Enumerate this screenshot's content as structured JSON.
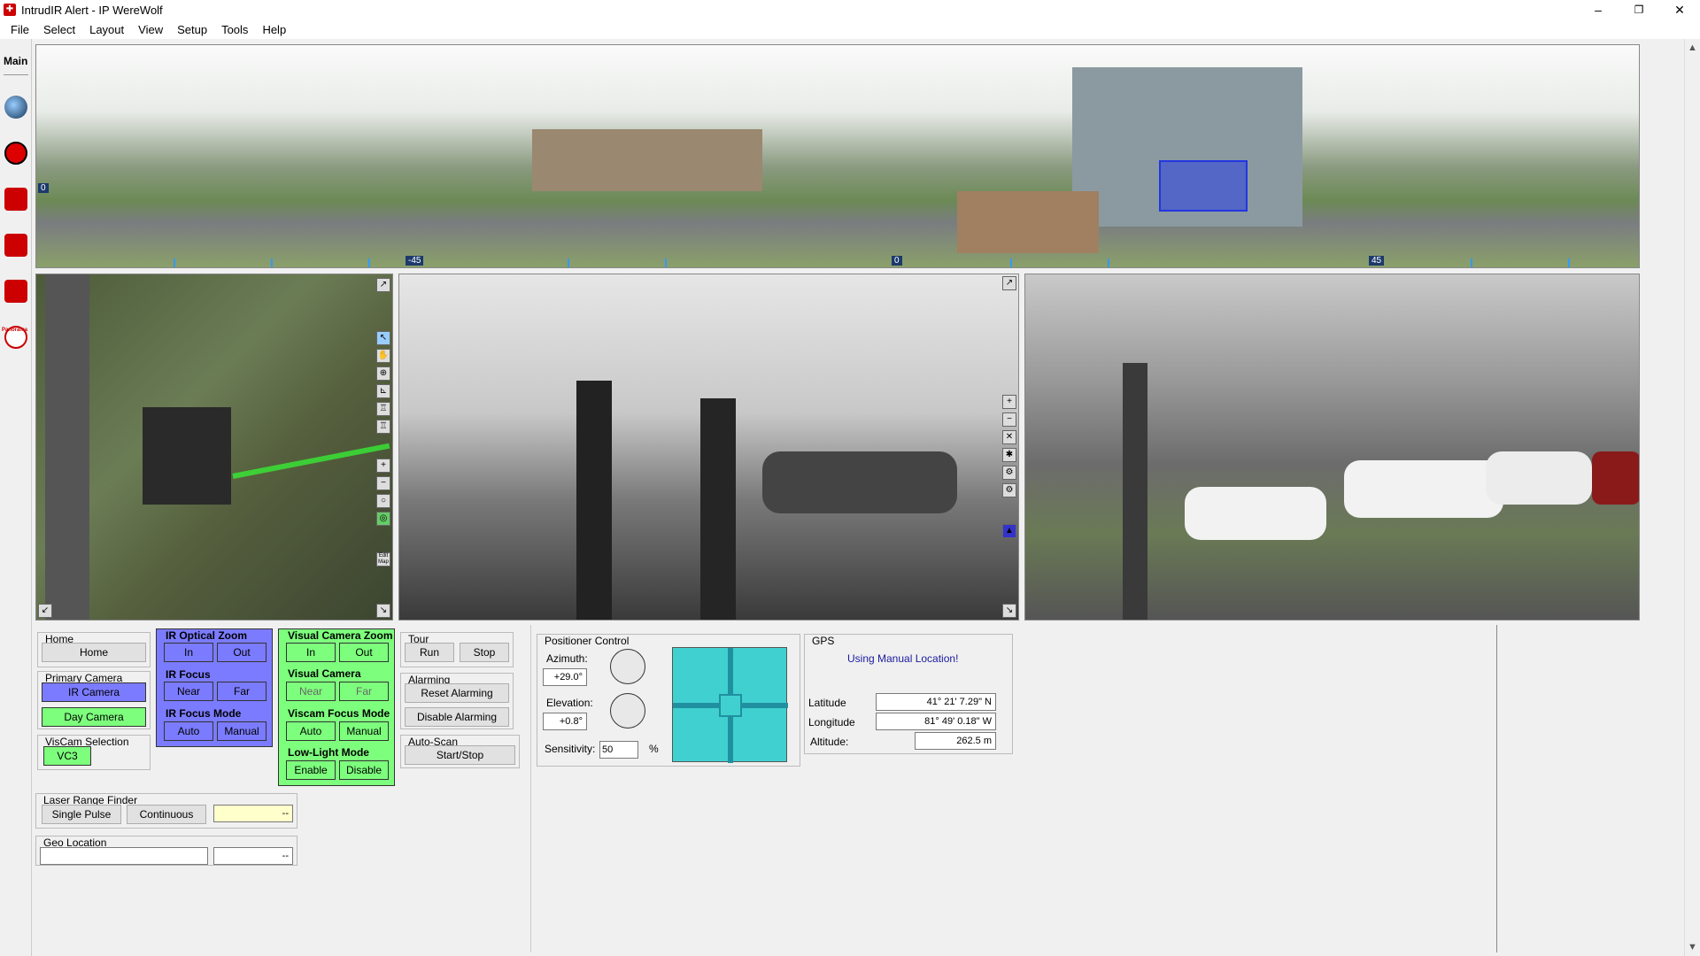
{
  "window": {
    "title": "IntrudIR Alert - IP WereWolf",
    "minimize": "–",
    "maximize": "❐",
    "close": "✕"
  },
  "menu": [
    "File",
    "Select",
    "Layout",
    "View",
    "Setup",
    "Tools",
    "Help"
  ],
  "sidebar": {
    "main_label": "Main",
    "items": [
      "globe-icon",
      "target-icon",
      "camera-icon-1",
      "camera-icon-2",
      "camera-icon-3",
      "panorama-icon"
    ],
    "panorama_caption": "Panorama"
  },
  "panorama": {
    "ticks": [
      "-45",
      "0",
      "45"
    ],
    "left_marker": "0"
  },
  "map_tools": {
    "edit_map": "Edit Map"
  },
  "controls": {
    "home": {
      "label": "Home",
      "button": "Home"
    },
    "primary_camera": {
      "label": "Primary Camera",
      "ir": "IR Camera",
      "day": "Day Camera"
    },
    "viscam_selection": {
      "label": "VisCam Selection",
      "value": "VC3"
    },
    "ir_optical_zoom": {
      "label": "IR Optical Zoom",
      "in": "In",
      "out": "Out"
    },
    "ir_focus": {
      "label": "IR Focus",
      "near": "Near",
      "far": "Far"
    },
    "ir_focus_mode": {
      "label": "IR Focus Mode",
      "auto": "Auto",
      "manual": "Manual"
    },
    "visual_zoom": {
      "label": "Visual Camera Zoom",
      "in": "In",
      "out": "Out"
    },
    "visual_camera": {
      "label": "Visual Camera",
      "near": "Near",
      "far": "Far"
    },
    "viscam_focus_mode": {
      "label": "Viscam Focus Mode",
      "auto": "Auto",
      "manual": "Manual"
    },
    "low_light": {
      "label": "Low-Light Mode",
      "enable": "Enable",
      "disable": "Disable"
    },
    "tour": {
      "label": "Tour",
      "run": "Run",
      "stop": "Stop"
    },
    "alarming": {
      "label": "Alarming",
      "reset": "Reset Alarming",
      "disable": "Disable Alarming"
    },
    "autoscan": {
      "label": "Auto-Scan",
      "button": "Start/Stop"
    },
    "laser": {
      "label": "Laser Range Finder",
      "single": "Single Pulse",
      "continuous": "Continuous",
      "value": "--"
    },
    "geo": {
      "label": "Geo Location",
      "value": "",
      "value2": "--"
    }
  },
  "positioner": {
    "label": "Positioner Control",
    "azimuth_label": "Azimuth:",
    "azimuth": "+29.0°",
    "elevation_label": "Elevation:",
    "elevation": "+0.8°",
    "sensitivity_label": "Sensitivity:",
    "sensitivity": "50",
    "percent": "%"
  },
  "gps": {
    "label": "GPS",
    "status": "Using Manual Location!",
    "lat_label": "Latitude",
    "lat": "41° 21' 7.29\" N",
    "lon_label": "Longitude",
    "lon": "81° 49' 0.18\" W",
    "alt_label": "Altitude:",
    "alt": "262.5 m"
  },
  "colors": {
    "ir_blue": "#7b7bff",
    "vis_green": "#7dff7d",
    "dpad": "#40d0d0"
  }
}
